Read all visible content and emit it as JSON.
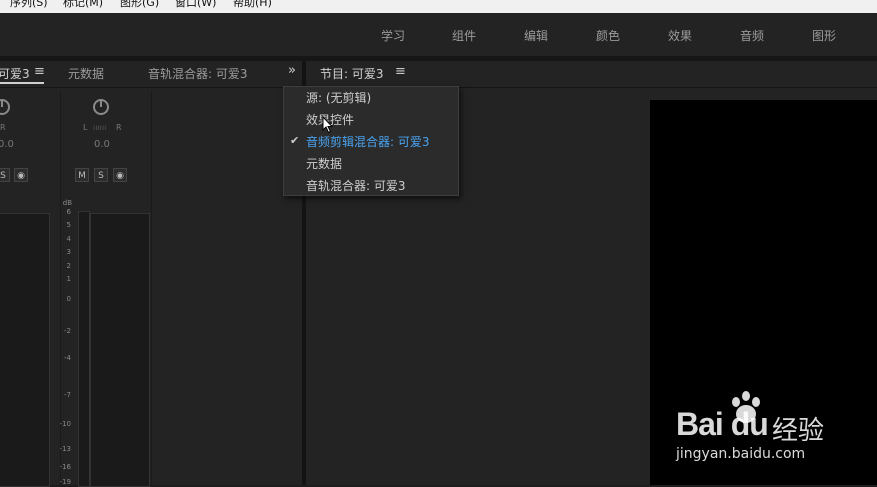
{
  "menubar": {
    "items": [
      "序列(S)",
      "标记(M)",
      "图形(G)",
      "窗口(W)",
      "帮助(H)"
    ]
  },
  "workspaces": [
    "学习",
    "组件",
    "编辑",
    "颜色",
    "效果",
    "音频",
    "图形"
  ],
  "left_panel": {
    "tabs": [
      "可爱3",
      "元数据",
      "音轨混合器: 可爱3"
    ],
    "hamburger": "≡",
    "overflow": "»",
    "channel": {
      "l": "L",
      "r": "R",
      "pan_value": "0.0",
      "buttons": [
        "M",
        "S",
        "◉"
      ],
      "db_label": "dB",
      "db_scale": [
        "6",
        "5",
        "4",
        "3",
        "2",
        "1",
        "0",
        "-2",
        "-4",
        "-7",
        "-10",
        "-13",
        "-16",
        "-19"
      ]
    }
  },
  "right_panel": {
    "tab": "节目: 可爱3",
    "hamburger": "≡"
  },
  "dropdown": {
    "items": [
      {
        "label": "源: (无剪辑)",
        "checked": false
      },
      {
        "label": "效果控件",
        "checked": false
      },
      {
        "label": "音频剪辑混合器: 可爱3",
        "checked": true
      },
      {
        "label": "元数据",
        "checked": false
      },
      {
        "label": "音轨混合器: 可爱3",
        "checked": false
      }
    ],
    "check_glyph": "✔",
    "accent": "#4aa3f0"
  },
  "watermark": {
    "brand": "Bai du",
    "cn": "经验",
    "url": "jingyan.baidu.com"
  }
}
